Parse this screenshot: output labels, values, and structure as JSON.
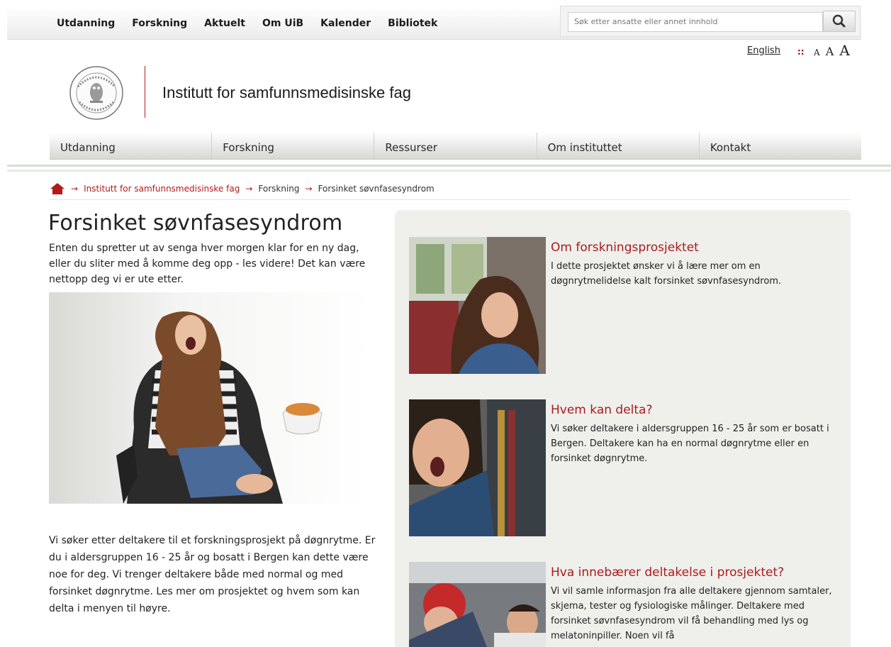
{
  "topnav": [
    "Utdanning",
    "Forskning",
    "Aktuelt",
    "Om UiB",
    "Kalender",
    "Bibliotek"
  ],
  "search": {
    "placeholder": "Søk etter ansatte eller annet innhold"
  },
  "lang": {
    "english": "English",
    "separator": "::",
    "font_small": "A",
    "font_medium": "A",
    "font_large": "A"
  },
  "header": {
    "title": "Institutt for samfunnsmedisinske fag"
  },
  "mainnav": [
    "Utdanning",
    "Forskning",
    "Ressurser",
    "Om instituttet",
    "Kontakt"
  ],
  "breadcrumb": {
    "level1": "Institutt for samfunnsmedisinske fag",
    "level2": "Forskning",
    "level3": "Forsinket søvnfasesyndrom"
  },
  "page": {
    "title": "Forsinket søvnfasesyndrom",
    "intro": "Enten du spretter ut av senga hver morgen klar for en ny dag, eller du sliter med å komme deg opp - les videre! Det kan være nettopp deg vi er ute etter.",
    "body": "Vi søker etter deltakere til et forskningsprosjekt på døgnrytme. Er du i aldersgruppen 16 - 25 år og bosatt i Bergen kan dette være noe for deg. Vi trenger deltakere både med normal og med forsinket døgnrytme. Les mer om prosjektet og hvem som kan delta i menyen til høyre."
  },
  "items": [
    {
      "title": "Om forskningsprosjektet",
      "text": "I dette prosjektet ønsker vi å lære mer om en døgnrytmelidelse kalt forsinket søvnfasesyndrom."
    },
    {
      "title": "Hvem kan delta?",
      "text": "Vi søker deltakere i aldersgruppen 16 - 25 år som er bosatt i Bergen. Deltakere kan ha en normal døgnrytme eller en forsinket døgnrytme."
    },
    {
      "title": "Hva innebærer deltakelse i prosjektet?",
      "text": "Vi vil samle informasjon fra alle deltakere gjennom samtaler, skjema, tester og fysiologiske målinger. Deltakere med forsinket søvnfasesyndrom vil få behandling med lys og melatoninpiller. Noen vil få"
    }
  ],
  "colors": {
    "accent": "#b31b1b",
    "panel": "#efefec"
  }
}
